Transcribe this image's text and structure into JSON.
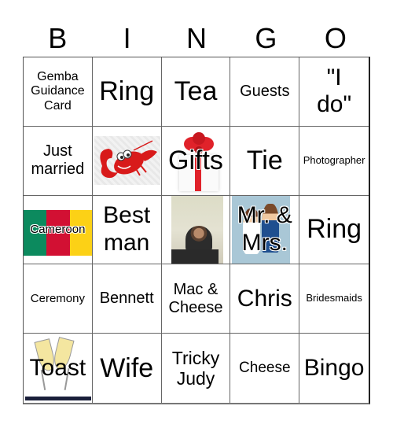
{
  "header": {
    "letters": [
      "B",
      "I",
      "N",
      "G",
      "O"
    ]
  },
  "cells": [
    {
      "text": "Gemba\nGuidance\nCard",
      "image": null
    },
    {
      "text": "Ring",
      "image": null
    },
    {
      "text": "Tea",
      "image": null
    },
    {
      "text": "Guests",
      "image": null
    },
    {
      "text": "\"I\ndo\"",
      "image": null
    },
    {
      "text": "Just\nmarried",
      "image": null
    },
    {
      "text": "",
      "image": "lobster"
    },
    {
      "text": "Gifts",
      "image": "gift-box"
    },
    {
      "text": "Tie",
      "image": null
    },
    {
      "text": "Photographer",
      "image": null
    },
    {
      "text": "Cameroon",
      "image": "cameroon-flag"
    },
    {
      "text": "Best\nman",
      "image": null
    },
    {
      "text": "",
      "image": "teacher-photo"
    },
    {
      "text": "Mr. &\nMrs.",
      "image": "bride-and-groom"
    },
    {
      "text": "Ring",
      "image": null
    },
    {
      "text": "Ceremony",
      "image": null
    },
    {
      "text": "Bennett",
      "image": null
    },
    {
      "text": "Mac &\nCheese",
      "image": null
    },
    {
      "text": "Chris",
      "image": null
    },
    {
      "text": "Bridesmaids",
      "image": null
    },
    {
      "text": "Toast",
      "image": "champagne-glasses"
    },
    {
      "text": "Wife",
      "image": null
    },
    {
      "text": "Tricky\nJudy",
      "image": null
    },
    {
      "text": "Cheese",
      "image": null
    },
    {
      "text": "Bingo",
      "image": null
    }
  ],
  "colors": {
    "flag_green": "#0c8a5e",
    "flag_red": "#d21033",
    "flag_yellow": "#fcd116",
    "lobster_red": "#d81a1a",
    "ribbon_red": "#e0222a"
  }
}
